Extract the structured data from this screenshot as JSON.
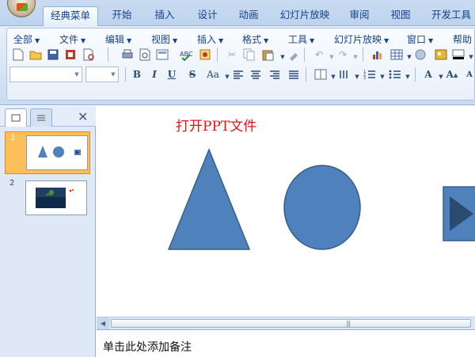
{
  "ribbon_tabs": [
    {
      "label": "经典菜单",
      "active": true
    },
    {
      "label": "开始"
    },
    {
      "label": "插入"
    },
    {
      "label": "设计"
    },
    {
      "label": "动画"
    },
    {
      "label": "幻灯片放映"
    },
    {
      "label": "审阅"
    },
    {
      "label": "视图"
    },
    {
      "label": "开发工具"
    }
  ],
  "menu_bar": [
    {
      "label": "全部"
    },
    {
      "label": "文件"
    },
    {
      "label": "编辑"
    },
    {
      "label": "视图"
    },
    {
      "label": "插入"
    },
    {
      "label": "格式"
    },
    {
      "label": "工具"
    },
    {
      "label": "幻灯片放映"
    },
    {
      "label": "窗口"
    },
    {
      "label": "帮助"
    }
  ],
  "format_buttons": {
    "bold": "B",
    "italic": "I",
    "underline": "U",
    "shadow": "S",
    "font_size": "Aa"
  },
  "slides_panel": {
    "thumbnails": [
      {
        "number": "1",
        "selected": true
      },
      {
        "number": "2",
        "selected": false
      }
    ]
  },
  "slide": {
    "title": "打开PPT文件",
    "shape_fill": "#4f81bd",
    "shape_stroke": "#385d8a"
  },
  "notes": {
    "placeholder": "单击此处添加备注"
  },
  "colors": {
    "accent": "#4f81bd",
    "title_red": "#e81010",
    "selected_slide": "#fcbf5a"
  }
}
